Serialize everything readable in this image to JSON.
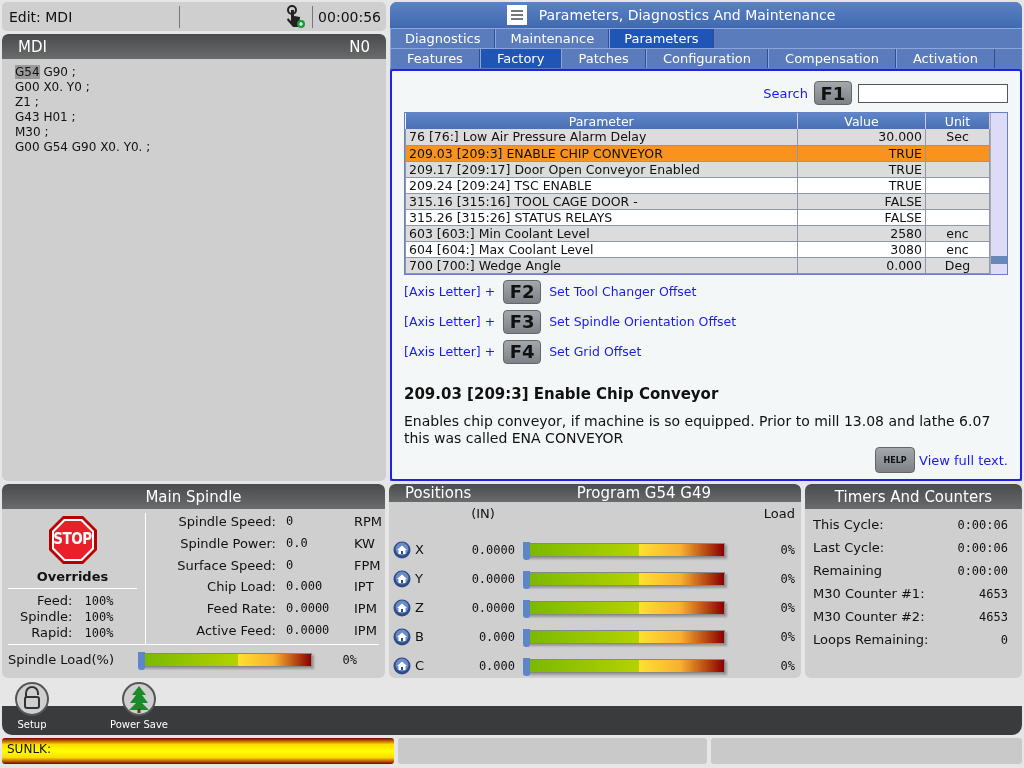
{
  "header": {
    "mode": "Edit: MDI",
    "timer": "00:00:56"
  },
  "program": {
    "title": "MDI",
    "line_number": "N0",
    "lines": [
      {
        "cursor": "G54",
        "text": " G90 ;"
      },
      {
        "text": "G00 X0. Y0 ;"
      },
      {
        "text": "Z1 ;"
      },
      {
        "text": "G43 H01 ;"
      },
      {
        "text": "M30 ;"
      },
      {
        "text": "G00 G54 G90 X0. Y0. ;"
      }
    ]
  },
  "parameters": {
    "title": "Parameters, Diagnostics And Maintenance",
    "tabs": [
      {
        "label": "Diagnostics",
        "selected": false
      },
      {
        "label": "Maintenance",
        "selected": false
      },
      {
        "label": "Parameters",
        "selected": true
      }
    ],
    "subtabs": [
      {
        "label": "Features",
        "selected": false
      },
      {
        "label": "Factory",
        "selected": true
      },
      {
        "label": "Patches",
        "selected": false
      },
      {
        "label": "Configuration",
        "selected": false
      },
      {
        "label": "Compensation",
        "selected": false
      },
      {
        "label": "Activation",
        "selected": false
      }
    ],
    "search": {
      "label": "Search",
      "key": "F1"
    },
    "table": {
      "columns": [
        "Parameter",
        "Value",
        "Unit"
      ],
      "rows": [
        {
          "parameter": "76 [76:] Low Air Pressure Alarm Delay",
          "value": "30.000",
          "unit": "Sec",
          "selected": false
        },
        {
          "parameter": "209.03 [209:3] ENABLE CHIP CONVEYOR",
          "value": "TRUE",
          "selected": true
        },
        {
          "parameter": "209.17 [209:17] Door Open Conveyor Enabled",
          "value": "TRUE",
          "selected": false
        },
        {
          "parameter": "209.24 [209:24] TSC ENABLE",
          "value": "TRUE",
          "selected": false
        },
        {
          "parameter": "315.16 [315:16] TOOL CAGE DOOR -",
          "value": "FALSE",
          "selected": false
        },
        {
          "parameter": "315.26 [315:26] STATUS RELAYS",
          "value": "FALSE",
          "selected": false
        },
        {
          "parameter": "603 [603:] Min Coolant Level",
          "value": "2580",
          "unit": "enc",
          "selected": false
        },
        {
          "parameter": "604 [604:] Max Coolant Level",
          "value": "3080",
          "unit": "enc",
          "selected": false
        },
        {
          "parameter": "700 [700:] Wedge Angle",
          "value": "0.000",
          "unit": "Deg",
          "selected": false
        }
      ]
    },
    "shortcuts": [
      {
        "prefix": "[Axis Letter] +",
        "key": "F2",
        "label": "Set Tool Changer Offset"
      },
      {
        "prefix": "[Axis Letter] +",
        "key": "F3",
        "label": "Set Spindle Orientation Offset"
      },
      {
        "prefix": "[Axis Letter] +",
        "key": "F4",
        "label": "Set Grid Offset"
      }
    ],
    "description": {
      "title": "209.03 [209:3] Enable Chip Conveyor",
      "text": "Enables chip conveyor, if machine is so equipped. Prior to mill 13.08 and lathe 6.07 this was called ENA CONVEYOR"
    },
    "help": {
      "key": "HELP",
      "link": "View full text."
    }
  },
  "spindle": {
    "title": "Main Spindle",
    "stop": "STOP",
    "overrides_title": "Overrides",
    "overrides": [
      {
        "label": "Feed:",
        "value": "100%"
      },
      {
        "label": "Spindle:",
        "value": "100%"
      },
      {
        "label": "Rapid:",
        "value": "100%"
      }
    ],
    "stats": [
      {
        "label": "Spindle Speed:",
        "value": "0",
        "unit": "RPM"
      },
      {
        "label": "Spindle Power:",
        "value": "0.0",
        "unit": "KW"
      },
      {
        "label": "Surface Speed:",
        "value": "0",
        "unit": "FPM"
      },
      {
        "label": "Chip Load:",
        "value": "0.000",
        "unit": "IPT"
      },
      {
        "label": "Feed Rate:",
        "value": "0.0000",
        "unit": "IPM"
      },
      {
        "label": "Active Feed:",
        "value": "0.0000",
        "unit": "IPM"
      }
    ],
    "load": {
      "label": "Spindle Load(%)",
      "level": 0,
      "reading": "0%"
    }
  },
  "positions": {
    "title": "Positions",
    "subtitle": "Program G54 G49",
    "unit_label": "(IN)",
    "load_label": "Load",
    "axes": [
      {
        "axis": "X",
        "value": "0.0000",
        "level": 0,
        "reading": "0%"
      },
      {
        "axis": "Y",
        "value": "0.0000",
        "level": 0,
        "reading": "0%"
      },
      {
        "axis": "Z",
        "value": "0.0000",
        "level": 0,
        "reading": "0%"
      },
      {
        "axis": "B",
        "value": "0.000",
        "level": 0,
        "reading": "0%"
      },
      {
        "axis": "C",
        "value": "0.000",
        "level": 0,
        "reading": "0%"
      }
    ]
  },
  "timers": {
    "title": "Timers And Counters",
    "rows": [
      {
        "label": "This Cycle:",
        "value": "0:00:06"
      },
      {
        "label": "Last Cycle:",
        "value": "0:00:06"
      },
      {
        "label": "Remaining",
        "value": "0:00:00"
      },
      {
        "label": "M30 Counter #1:",
        "value": "4653"
      },
      {
        "label": "M30 Counter #2:",
        "value": "4653"
      },
      {
        "label": "Loops Remaining:",
        "value": "0"
      }
    ]
  },
  "toolbar": [
    {
      "kind": "lock",
      "label": "Setup"
    },
    {
      "kind": "tree",
      "label": "Power Save"
    }
  ],
  "status_bar": {
    "message": "SUNLK:"
  }
}
